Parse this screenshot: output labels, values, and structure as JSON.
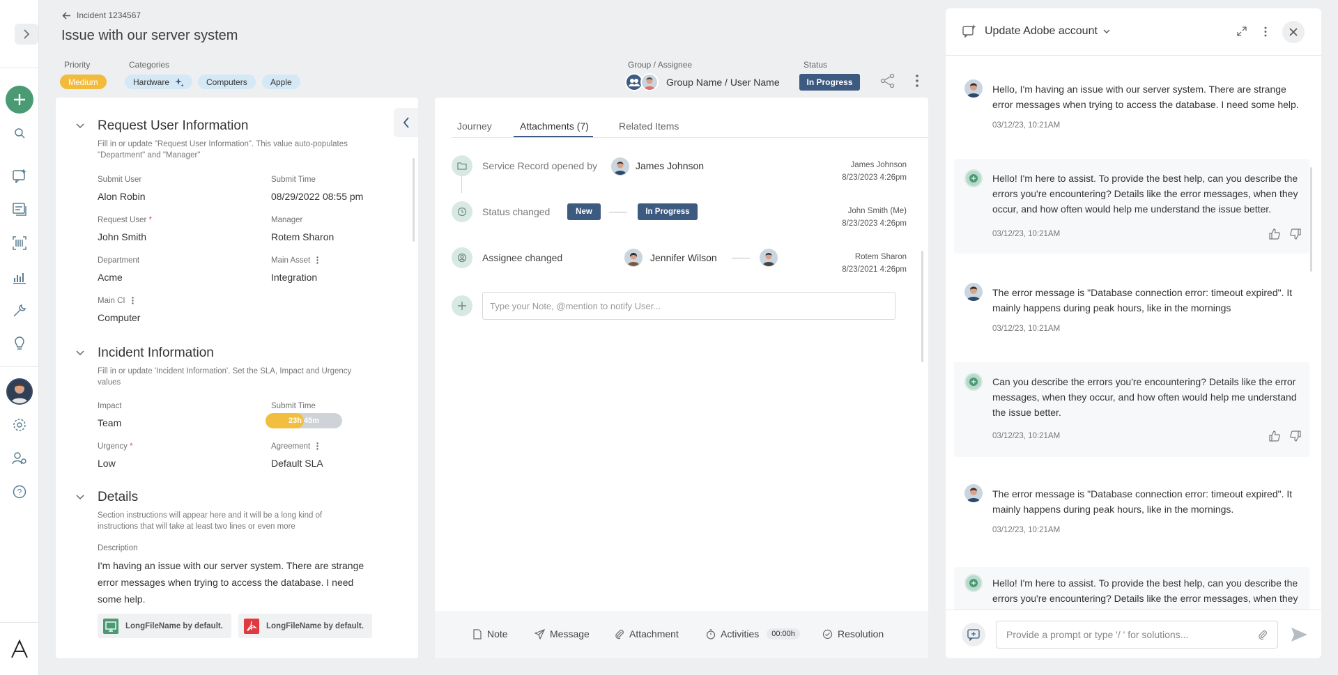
{
  "header": {
    "back_label": "Incident 1234567",
    "title": "Issue with our server system",
    "priority_label": "Priority",
    "priority_value": "Medium",
    "categories_label": "Categories",
    "categories": [
      "Hardware",
      "Computers",
      "Apple"
    ],
    "group_assignee_label": "Group / Assignee",
    "group_assignee_value": "Group Name / User Name",
    "status_label": "Status",
    "status_value": "In Progress"
  },
  "left_panel": {
    "request_section": {
      "title": "Request User Information",
      "desc": "Fill in or update \"Request User Information\". This value auto-populates \"Department\" and \"Manager\"",
      "fields": {
        "submit_user_label": "Submit User",
        "submit_user": "Alon Robin",
        "submit_time_label": "Submit Time",
        "submit_time": "08/29/2022  08:55 pm",
        "request_user_label": "Request User",
        "request_user": "John Smith",
        "manager_label": "Manager",
        "manager": "Rotem Sharon",
        "department_label": "Department",
        "department": "Acme",
        "main_asset_label": "Main Asset",
        "main_asset": "Integration",
        "main_ci_label": "Main CI",
        "main_ci": "Computer"
      }
    },
    "incident_section": {
      "title": "Incident Information",
      "desc": "Fill in or update 'Incident Information'. Set the SLA, Impact and Urgency values",
      "fields": {
        "impact_label": "Impact",
        "impact": "Team",
        "submit_time_label": "Submit Time",
        "sla_time": "23h 45m",
        "sla_progress": 0.5,
        "urgency_label": "Urgency",
        "urgency": "Low",
        "agreement_label": "Agreement",
        "agreement": "Default SLA"
      }
    },
    "details_section": {
      "title": "Details",
      "desc": "Section instructions will appear here and it will be a long kind of instructions that will take at least two lines or even more",
      "description_label": "Description",
      "description": "I'm having an issue with our server system. There are strange error messages when trying to access the database. I need some help.",
      "files": [
        "LongFileName by default.",
        "LongFileName by default."
      ]
    }
  },
  "mid_panel": {
    "tabs": [
      "Journey",
      "Attachments (7)",
      "Related  Items"
    ],
    "timeline": [
      {
        "text": "Service Record opened by",
        "name": "James Johnson",
        "meta_name": "James Johnson",
        "meta_date": "8/23/2023 4:26pm"
      },
      {
        "text": "Status changed",
        "from": "New",
        "to": "In Progress",
        "meta_name": "John Smith (Me)",
        "meta_date": "8/23/2023 4:26pm"
      },
      {
        "text": "Assignee changed",
        "name": "Jennifer Wilson",
        "meta_name": "Rotem Sharon",
        "meta_date": "8/23/2021 4:26pm"
      }
    ],
    "note_placeholder": "Type your Note, @mention to notify User...",
    "actions": [
      "Note",
      "Message",
      "Attachment",
      "Activities",
      "Resolution"
    ],
    "timer": "00:00h"
  },
  "chat": {
    "title": "Update Adobe account",
    "messages": [
      {
        "role": "user",
        "text": "Hello, I'm having an issue with our server system. There are strange error messages when trying to access the database. I need some help.",
        "time": "03/12/23, 10:21AM"
      },
      {
        "role": "bot",
        "text": "Hello! I'm here to assist. To provide the best help, can you describe the errors you're encountering? Details like the error messages, when they occur, and how often would help me understand the issue better.",
        "time": "03/12/23, 10:21AM"
      },
      {
        "role": "user",
        "text": "The error message is \"Database connection error: timeout expired\". It mainly happens during peak hours, like in the mornings",
        "time": "03/12/23, 10:21AM"
      },
      {
        "role": "bot",
        "text": "Can you describe the errors you're encountering? Details like the error messages, when they occur, and how often would help me understand the issue better.",
        "time": "03/12/23, 10:21AM"
      },
      {
        "role": "user",
        "text": "The error message is \"Database connection error: timeout expired\". It mainly happens during peak hours, like in the mornings.",
        "time": "03/12/23, 10:21AM"
      },
      {
        "role": "bot",
        "text": "Hello! I'm here to assist. To provide the best help, can you describe the errors you're encountering? Details like the error messages, when they",
        "time": ""
      }
    ],
    "prompt_placeholder": "Provide a prompt or type '/ ' for solutions..."
  },
  "colors": {
    "accent": "#3d5a80",
    "primary_green": "#4a9a74",
    "medium": "#f2bb3c"
  }
}
